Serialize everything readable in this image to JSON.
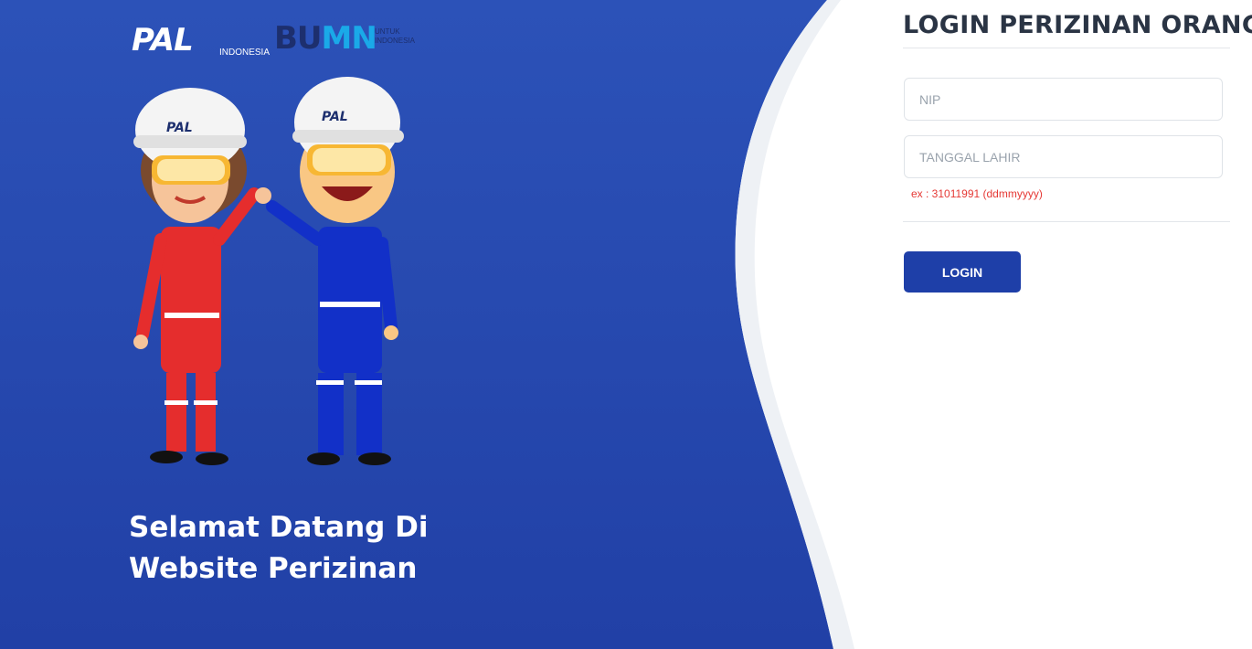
{
  "branding": {
    "pal_logo_text": "PAL",
    "pal_logo_subtext": "INDONESIA",
    "bumn_logo_text_a": "BU",
    "bumn_logo_text_b": "MN",
    "bumn_logo_subtext": "UNTUK INDONESIA",
    "helmet_logo_text": "PAL"
  },
  "hero": {
    "welcome_line1": "Selamat Datang Di",
    "welcome_line2": "Website Perizinan"
  },
  "login_form": {
    "title": "LOGIN PERIZINAN ORANG",
    "nip_placeholder": "NIP",
    "birthdate_placeholder": "TANGGAL LAHIR",
    "birthdate_hint": "ex : 31011991 (ddmmyyyy)",
    "submit_label": "LOGIN"
  },
  "colors": {
    "hero_blue": "#2a4db3",
    "button_blue": "#1e3fa8",
    "hint_red": "#e53935"
  }
}
